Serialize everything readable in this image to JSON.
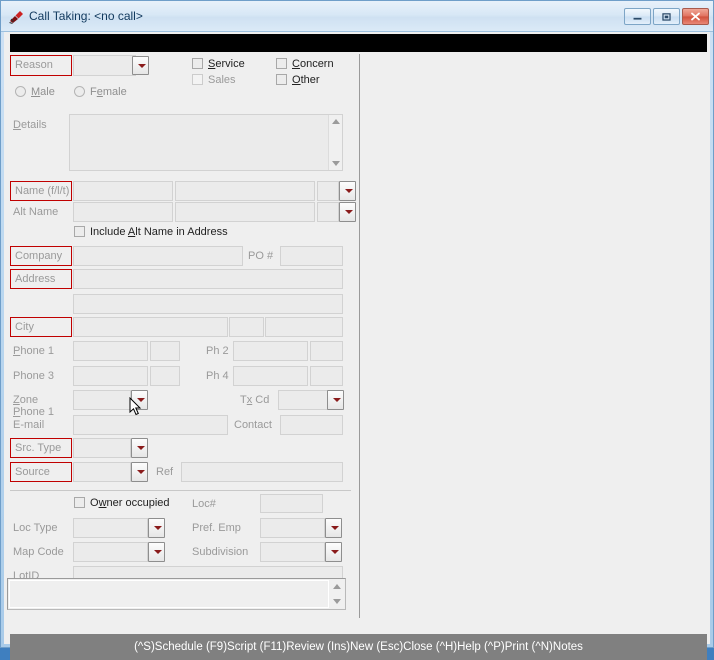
{
  "window": {
    "title": "Call Taking: <no call>",
    "icon": "app-icon",
    "buttons": {
      "minimize": "minimize-button",
      "maximize": "maximize-button",
      "close": "close-button"
    }
  },
  "form": {
    "reason": {
      "label": "Reason",
      "value": "",
      "required": true
    },
    "checkboxes": [
      {
        "label": "Service",
        "accel": "S",
        "checked": false,
        "disabled": false
      },
      {
        "label": "Sales",
        "accel": "",
        "checked": false,
        "disabled": true
      },
      {
        "label": "Concern",
        "accel": "C",
        "checked": false,
        "disabled": false
      },
      {
        "label": "Other",
        "accel": "O",
        "checked": false,
        "disabled": false
      }
    ],
    "gender": [
      {
        "label": "Male",
        "accel": "M",
        "selected": false
      },
      {
        "label": "Female",
        "accel": "e",
        "selected": false
      }
    ],
    "details": {
      "label": "Details",
      "value": ""
    },
    "name": {
      "label": "Name (f/l/t)",
      "first": "",
      "last": "",
      "title": "",
      "required": true
    },
    "alt_name": {
      "label": "Alt Name",
      "first": "",
      "last": "",
      "title": ""
    },
    "include_alt": {
      "label": "Include Alt Name in Address",
      "accel": "A",
      "checked": false
    },
    "company": {
      "label": "Company",
      "value": "",
      "required": true
    },
    "po_number": {
      "label": "PO #",
      "value": ""
    },
    "address": {
      "label": "Address",
      "line1": "",
      "line2": "",
      "required": true
    },
    "city": {
      "label": "City",
      "value": "",
      "state": "",
      "zip": "",
      "required": true
    },
    "phone1": {
      "label": "Phone 1",
      "value": "",
      "ext": ""
    },
    "phone2": {
      "label": "Ph 2",
      "value": "",
      "ext": ""
    },
    "phone3": {
      "label": "Phone 3",
      "value": "",
      "ext": ""
    },
    "phone4": {
      "label": "Ph 4",
      "value": "",
      "ext": ""
    },
    "zone": {
      "label": "Zone",
      "value": ""
    },
    "tax_code": {
      "label": "Tx Cd",
      "value": ""
    },
    "email": {
      "label": "E-mail",
      "value": ""
    },
    "contact": {
      "label": "Contact",
      "value": ""
    },
    "src_type": {
      "label": "Src. Type",
      "value": "",
      "required": true
    },
    "source": {
      "label": "Source",
      "value": "",
      "required": true
    },
    "ref": {
      "label": "Ref",
      "value": ""
    },
    "owner_occupied": {
      "label": "Owner occupied",
      "accel": "w",
      "checked": false
    },
    "loc_number": {
      "label": "Loc#",
      "value": ""
    },
    "loc_type": {
      "label": "Loc Type",
      "value": ""
    },
    "pref_emp": {
      "label": "Pref. Emp",
      "value": ""
    },
    "map_code": {
      "label": "Map Code",
      "value": ""
    },
    "subdivision": {
      "label": "Subdivision",
      "value": ""
    },
    "lot_id": {
      "label": "LotID",
      "value": ""
    }
  },
  "memo": {
    "value": ""
  },
  "statusbar": {
    "text": "(^S)Schedule  (F9)Script  (F11)Review  (Ins)New  (Esc)Close  (^H)Help  (^P)Print  (^N)Notes"
  },
  "colors": {
    "required_border": "#c00000",
    "status_bg": "#808080",
    "toolbar_bg": "#000000",
    "label_text": "#9a9a9a"
  }
}
